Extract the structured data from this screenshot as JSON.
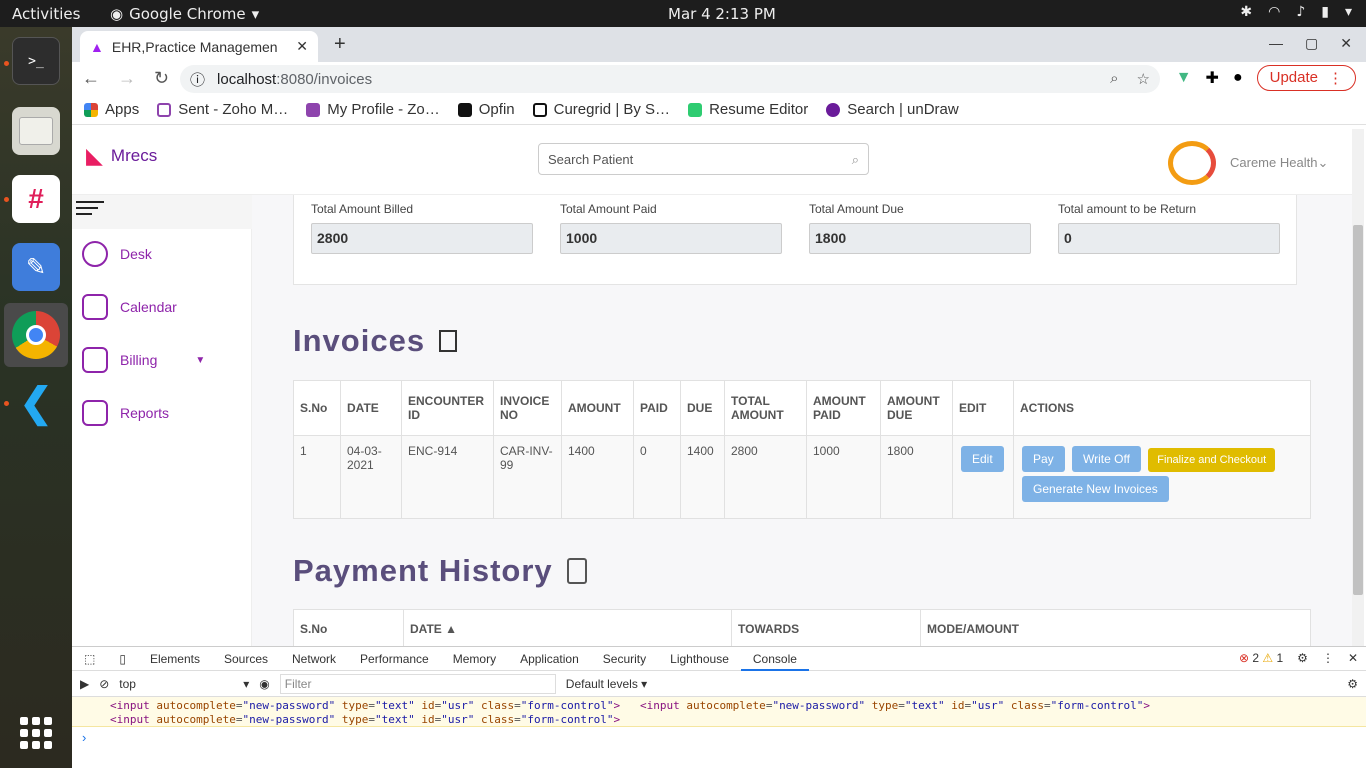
{
  "os": {
    "activities": "Activities",
    "app": "Google Chrome",
    "clock": "Mar 4  2:13 PM"
  },
  "browser": {
    "tab_title": "EHR,Practice Managemen",
    "url_host": "localhost",
    "url_path": ":8080/invoices",
    "update_label": "Update",
    "bookmarks": [
      "Apps",
      "Sent - Zoho M…",
      "My Profile - Zo…",
      "Opfin",
      "Curegrid | By S…",
      "Resume Editor",
      "Search | unDraw"
    ]
  },
  "app": {
    "brand": "Mrecs",
    "search_placeholder": "Search Patient",
    "org": "Careme Health",
    "nav": [
      {
        "label": "Desk"
      },
      {
        "label": "Calendar"
      },
      {
        "label": "Billing"
      },
      {
        "label": "Reports"
      }
    ]
  },
  "totals": [
    {
      "label": "Total Amount Billed",
      "value": "2800"
    },
    {
      "label": "Total Amount Paid",
      "value": "1000"
    },
    {
      "label": "Total Amount Due",
      "value": "1800"
    },
    {
      "label": "Total amount to be Return",
      "value": "0"
    }
  ],
  "invoices": {
    "title": "Invoices",
    "columns": [
      "S.No",
      "DATE",
      "ENCOUNTER ID",
      "INVOICE NO",
      "AMOUNT",
      "PAID",
      "DUE",
      "TOTAL AMOUNT",
      "AMOUNT PAID",
      "AMOUNT DUE",
      "EDIT",
      "ACTIONS"
    ],
    "rows": [
      {
        "sno": "1",
        "date": "04-03-2021",
        "enc": "ENC-914",
        "inv": "CAR-INV-99",
        "amount": "1400",
        "paid": "0",
        "due": "1400",
        "total": "2800",
        "apaid": "1000",
        "adue": "1800"
      }
    ],
    "edit_label": "Edit",
    "actions": {
      "pay": "Pay",
      "write_off": "Write Off",
      "finalize": "Finalize and Checkout",
      "generate": "Generate New Invoices"
    }
  },
  "payment_history": {
    "title": "Payment History",
    "columns": [
      "S.No",
      "DATE ▲",
      "TOWARDS",
      "MODE/AMOUNT"
    ]
  },
  "devtools": {
    "tabs": [
      "Elements",
      "Sources",
      "Network",
      "Performance",
      "Memory",
      "Application",
      "Security",
      "Lighthouse",
      "Console"
    ],
    "errors": "2",
    "warnings": "1",
    "context": "top",
    "filter_placeholder": "Filter",
    "levels": "Default levels",
    "console_tag": "input",
    "attr1": "autocomplete",
    "val1": "new-password",
    "attr2": "type",
    "val2": "text",
    "attr3": "id",
    "val3": "usr",
    "attr4": "class",
    "val4": "form-control",
    "prompt": "›"
  }
}
